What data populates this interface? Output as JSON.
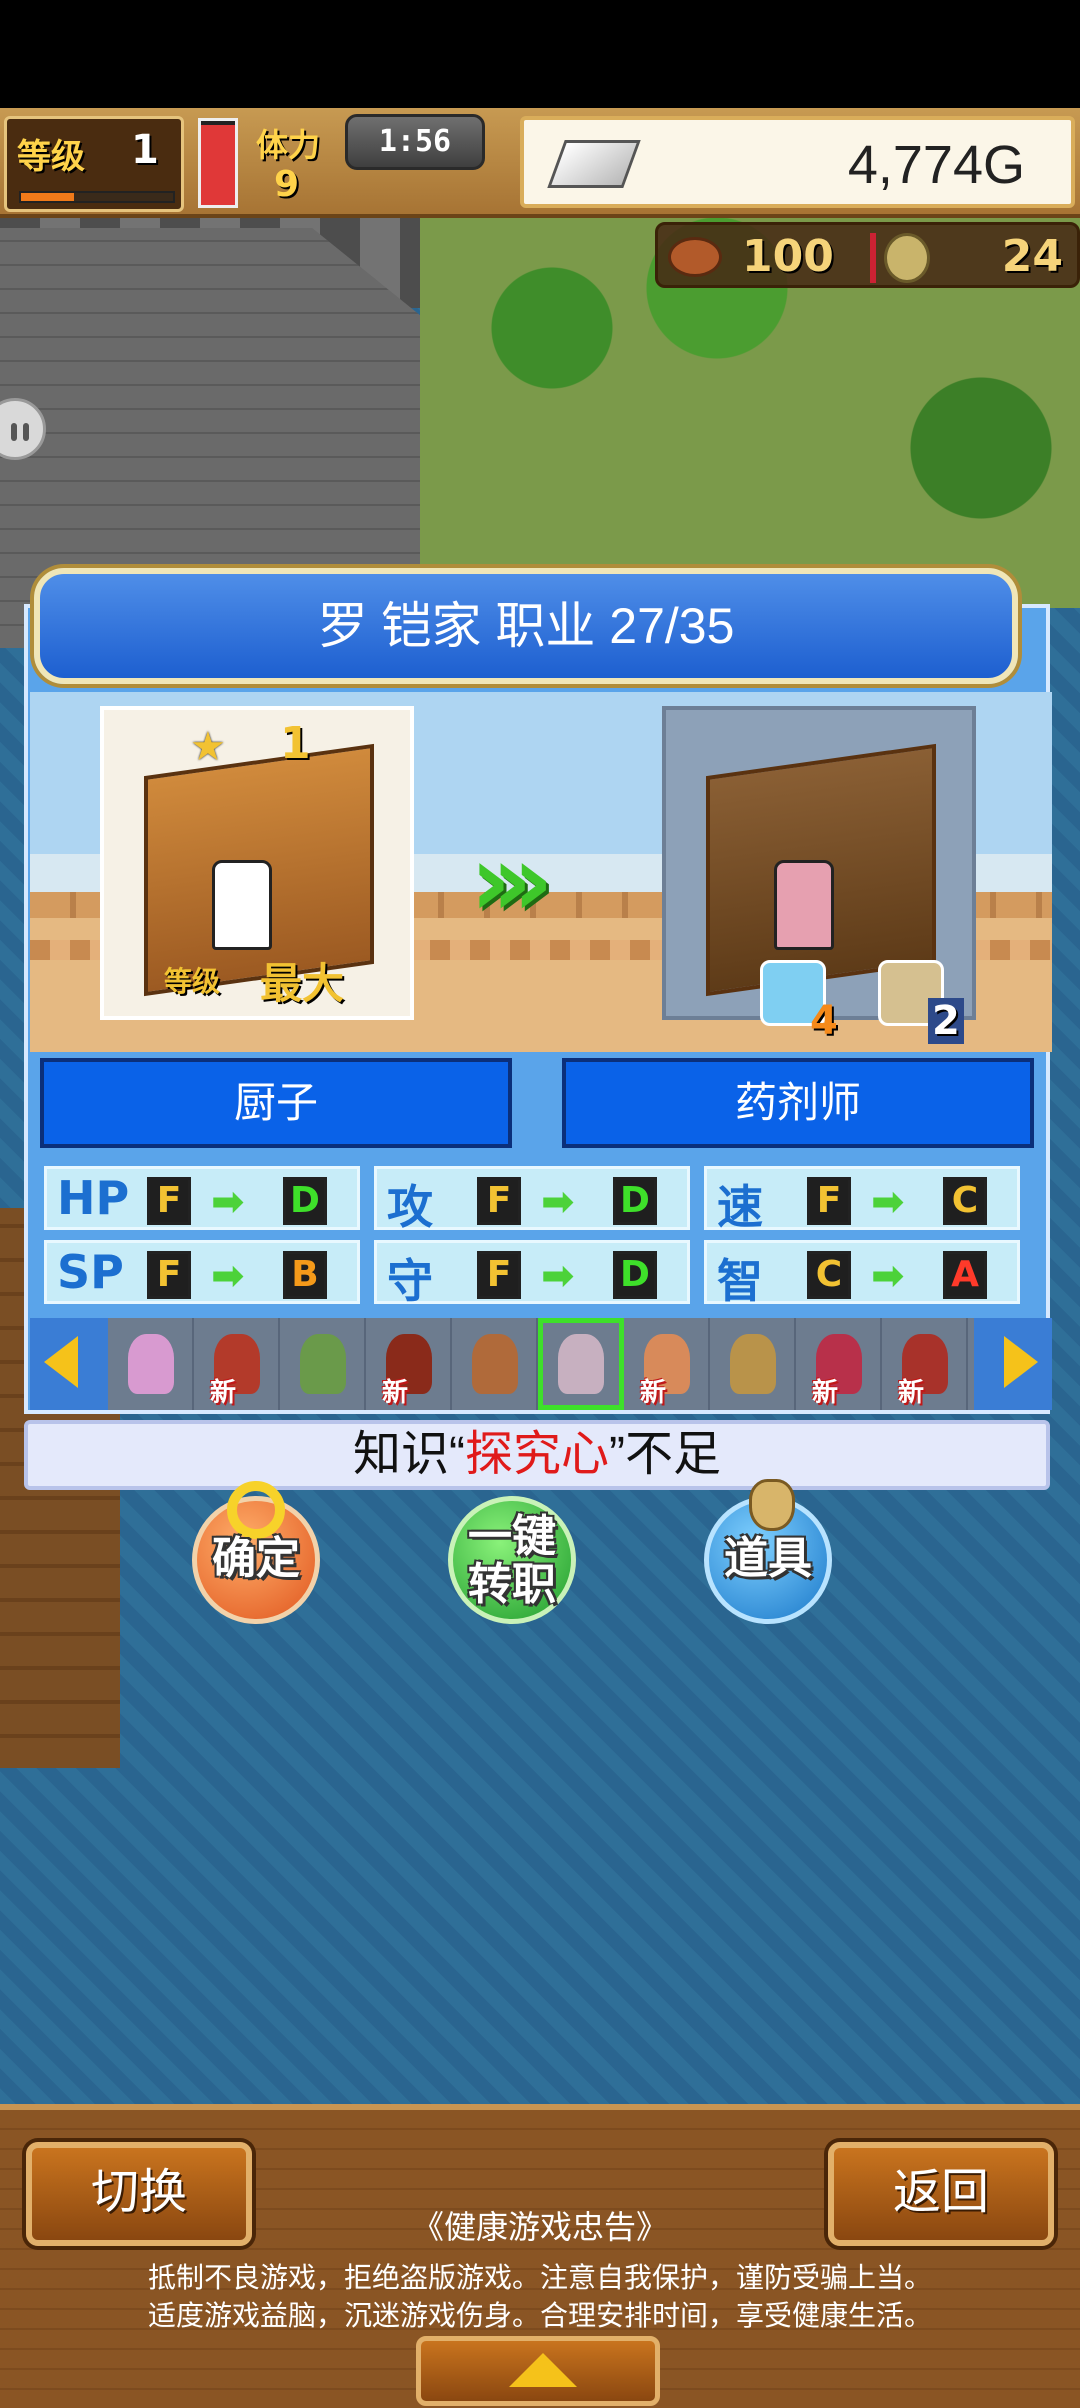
{
  "hud": {
    "level_label": "等级",
    "level_value": "1",
    "level_progress": 0.35,
    "stamina_label": "体力",
    "stamina_value": "9",
    "stamina_fill": 0.95,
    "timer": "1:56",
    "gold": "4,774G",
    "food": "100",
    "wood": "24"
  },
  "dialog": {
    "title": "罗 铠家  职业 27/35",
    "current_rank": "1",
    "current_level_label": "等级",
    "current_level_value": "最大",
    "requirements": [
      {
        "icon": "magnifier-icon",
        "value": "4"
      },
      {
        "icon": "fist-icon",
        "value": "2"
      }
    ],
    "job_from": "厨子",
    "job_to": "药剂师",
    "stats": [
      {
        "label": "HP",
        "from": "F",
        "to": "D"
      },
      {
        "label": "攻",
        "from": "F",
        "to": "D"
      },
      {
        "label": "速",
        "from": "F",
        "to": "C"
      },
      {
        "label": "SP",
        "from": "F",
        "to": "B"
      },
      {
        "label": "守",
        "from": "F",
        "to": "D"
      },
      {
        "label": "智",
        "from": "C",
        "to": "A"
      }
    ],
    "portraits": [
      {
        "new": ""
      },
      {
        "new": "新"
      },
      {
        "new": ""
      },
      {
        "new": "新"
      },
      {
        "new": ""
      },
      {
        "new": ""
      },
      {
        "new": "新"
      },
      {
        "new": ""
      },
      {
        "new": "新"
      },
      {
        "new": "新"
      }
    ],
    "selected_index": 5,
    "message_before": "知识“",
    "message_highlight": "探究心",
    "message_after": "”不足"
  },
  "actions": {
    "confirm": "确定",
    "change_line1": "一键",
    "change_line2": "转职",
    "item": "道具"
  },
  "bottom": {
    "switch": "切换",
    "back": "返回",
    "notice_title": "《健康游戏忠告》",
    "notice_line1": "抵制不良游戏，拒绝盗版游戏。注意自我保护，谨防受骗上当。",
    "notice_line2": "适度游戏益脑，沉迷游戏伤身。合理安排时间，享受健康生活。"
  },
  "colors": {
    "grade_D": "#3ee02a",
    "grade_C": "#f2c232",
    "grade_B": "#f59a1a",
    "grade_A": "#ff3a2a",
    "grade_F": "#f2c232"
  }
}
